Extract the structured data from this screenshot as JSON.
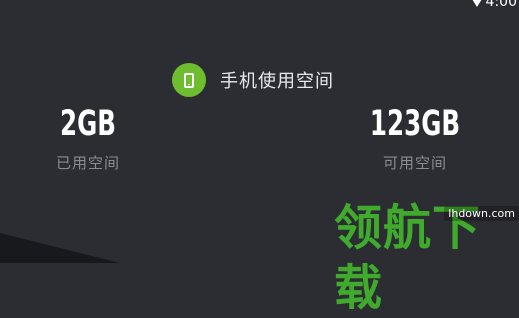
{
  "status_bar": {
    "time": "4:00",
    "wifi_icon": "wifi-icon"
  },
  "header": {
    "icon": "phone-icon",
    "icon_color": "#6ebd2f",
    "title": "手机使用空间"
  },
  "stats": {
    "used": {
      "value": "2GB",
      "label": "已用空间"
    },
    "available": {
      "value": "123GB",
      "label": "可用空间"
    }
  },
  "watermark": {
    "text": "领航下载",
    "url": "lhdown.com",
    "color": "#3faa2c"
  }
}
